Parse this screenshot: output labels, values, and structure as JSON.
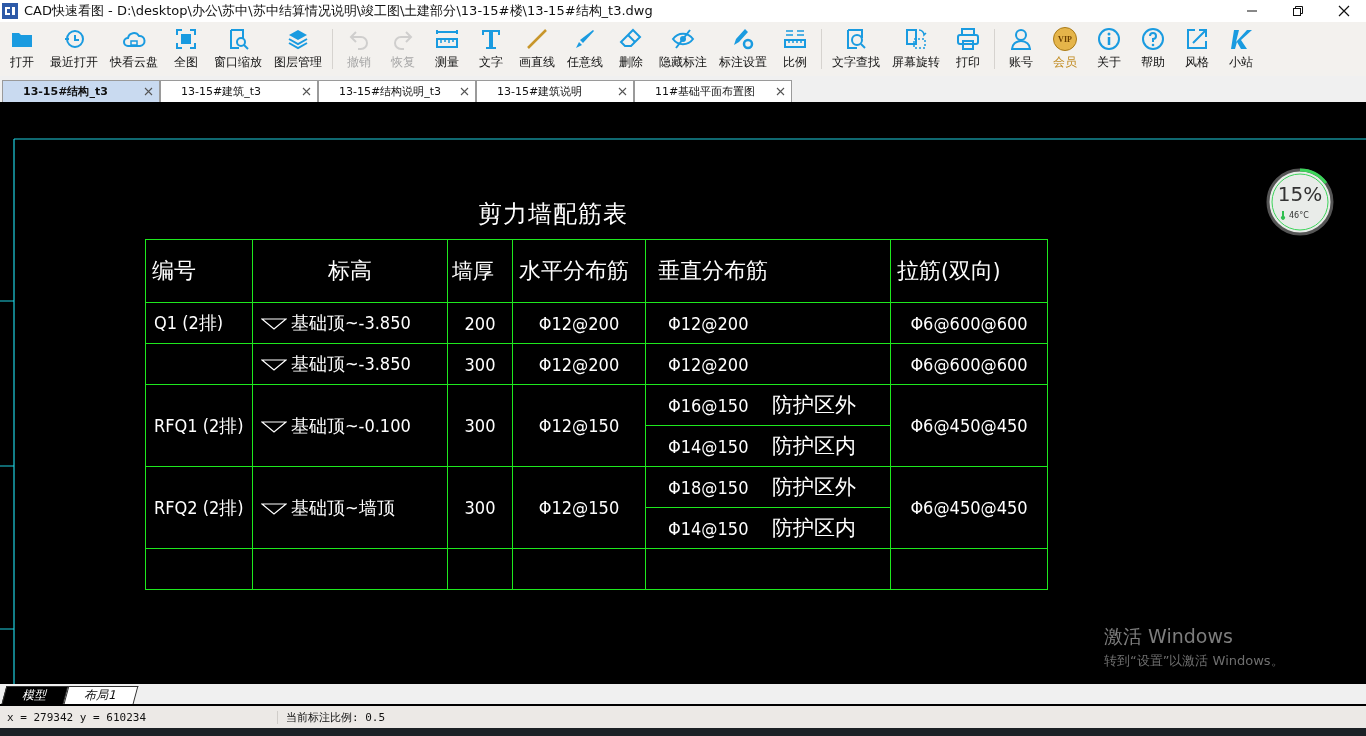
{
  "window": {
    "title": "CAD快速看图 - D:\\desktop\\办公\\苏中\\苏中结算情况说明\\竣工图\\土建部分\\13-15#楼\\13-15#结构_t3.dwg"
  },
  "toolbar": [
    {
      "items": [
        {
          "label": "打开",
          "kind": "tool",
          "disabled": false
        },
        {
          "label": "最近打开",
          "kind": "tool",
          "disabled": false
        },
        {
          "label": "快看云盘",
          "kind": "tool",
          "disabled": false
        },
        {
          "label": "全图",
          "kind": "tool",
          "disabled": false
        },
        {
          "label": "窗口缩放",
          "kind": "tool",
          "disabled": false
        },
        {
          "label": "图层管理",
          "kind": "tool",
          "disabled": false
        }
      ]
    },
    {
      "items": [
        {
          "label": "撤销",
          "kind": "tool",
          "disabled": true
        },
        {
          "label": "恢复",
          "kind": "tool",
          "disabled": true
        },
        {
          "label": "测量",
          "kind": "tool",
          "disabled": false
        },
        {
          "label": "文字",
          "kind": "tool",
          "disabled": false
        },
        {
          "label": "画直线",
          "kind": "tool",
          "disabled": false
        },
        {
          "label": "任意线",
          "kind": "tool",
          "disabled": false
        },
        {
          "label": "删除",
          "kind": "tool",
          "disabled": false
        },
        {
          "label": "隐藏标注",
          "kind": "tool",
          "disabled": false
        },
        {
          "label": "标注设置",
          "kind": "tool",
          "disabled": false
        },
        {
          "label": "比例",
          "kind": "tool",
          "disabled": false
        }
      ]
    },
    {
      "items": [
        {
          "label": "文字查找",
          "kind": "tool",
          "disabled": false
        },
        {
          "label": "屏幕旋转",
          "kind": "tool",
          "disabled": false
        },
        {
          "label": "打印",
          "kind": "tool",
          "disabled": false
        }
      ]
    },
    {
      "items": [
        {
          "label": "账号",
          "kind": "tool",
          "disabled": false
        },
        {
          "label": "会员",
          "kind": "badge",
          "badge": "VIP",
          "disabled": false
        },
        {
          "label": "关于",
          "kind": "tool",
          "disabled": false
        },
        {
          "label": "帮助",
          "kind": "tool",
          "disabled": false
        },
        {
          "label": "风格",
          "kind": "tool",
          "disabled": false
        },
        {
          "label": "小站",
          "kind": "tool",
          "disabled": false
        }
      ]
    }
  ],
  "tabs": [
    {
      "label": "13-15#结构_t3",
      "selected": true
    },
    {
      "label": "13-15#建筑_t3",
      "selected": false
    },
    {
      "label": "13-15#结构说明_t3",
      "selected": false
    },
    {
      "label": "13-15#建筑说明",
      "selected": false
    },
    {
      "label": "11#基础平面布置图",
      "selected": false
    }
  ],
  "drawing": {
    "title": "剪力墙配筋表",
    "columns": [
      "编号",
      "标高",
      "墙厚",
      "水平分布筋",
      "垂直分布筋",
      "拉筋(双向)"
    ],
    "rows": [
      {
        "number": "Q1 (2排)",
        "elevation": "基础顶~-3.850",
        "thickness": "200",
        "horizontal": "Φ12@200",
        "vertical": [
          {
            "bar": "Φ12@200"
          }
        ],
        "tie": "Φ6@600@600"
      },
      {
        "elevation": "基础顶~-3.850",
        "thickness": "300",
        "horizontal": "Φ12@200",
        "vertical": [
          {
            "bar": "Φ12@200"
          }
        ],
        "tie": "Φ6@600@600"
      },
      {
        "number": "RFQ1 (2排)",
        "elevation": "基础顶~-0.100",
        "thickness": "300",
        "horizontal": "Φ12@150",
        "vertical": [
          {
            "bar": "Φ16@150",
            "zone": "防护区外"
          },
          {
            "bar": "Φ14@150",
            "zone": "防护区内"
          }
        ],
        "tie": "Φ6@450@450"
      },
      {
        "number": "RFQ2 (2排)",
        "elevation": "基础顶~墙顶",
        "thickness": "300",
        "horizontal": "Φ12@150",
        "vertical": [
          {
            "bar": "Φ18@150",
            "zone": "防护区外"
          },
          {
            "bar": "Φ14@150",
            "zone": "防护区内"
          }
        ],
        "tie": "Φ6@450@450"
      }
    ]
  },
  "gauge": {
    "reading": "15%",
    "temperature": "46°C",
    "level": 0.15
  },
  "activation_notice": {
    "title": "激活 Windows",
    "subtitle": "转到“设置”以激活 Windows。"
  },
  "layout_tabs": [
    {
      "label": "模型",
      "selected": true
    },
    {
      "label": "布局1",
      "selected": false
    }
  ],
  "status_bar": {
    "coordinates": "x = 279342 y = 610234",
    "scale": "当前标注比例: 0.5"
  }
}
